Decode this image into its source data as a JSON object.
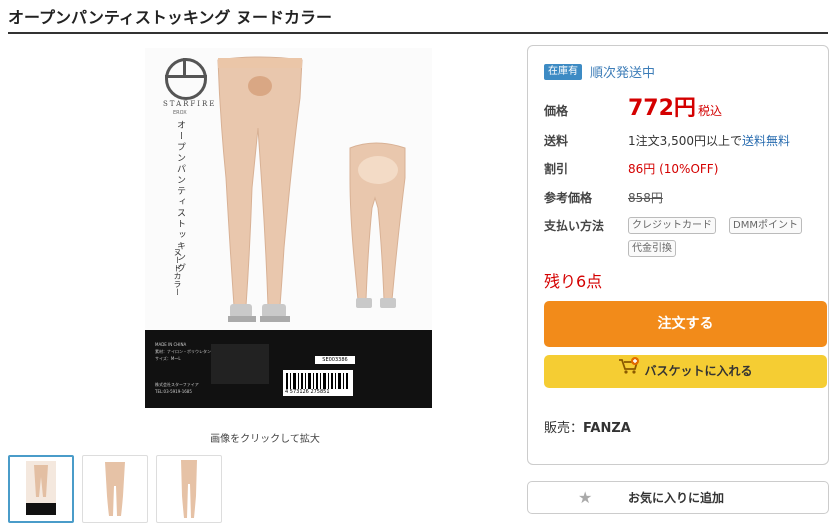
{
  "product": {
    "title": "オープンパンティストッキング ヌードカラー",
    "image_caption": "画像をクリックして拡大",
    "package": {
      "brand": "STARFIRE",
      "brand_sub": "EROX",
      "vertical_title": "オープンパンティストッキング",
      "vertical_sub": "ヌードカラー",
      "made_in": "MADE IN CHINA",
      "material_line": "素材：ナイロン・ポリウレタン",
      "size_line": "サイズ：M〜L",
      "maker_line": "株式会社スターファイア",
      "phone_line": "TEL:03-5919-1685",
      "barcode_number": "4 573126 275851",
      "code_label": "SE003386"
    },
    "thumbnails": [
      {
        "label": "thumb-1",
        "active": true
      },
      {
        "label": "thumb-2",
        "active": false
      },
      {
        "label": "thumb-3",
        "active": false
      }
    ]
  },
  "purchase": {
    "stock_badge": "在庫有",
    "shipping_status": "順次発送中",
    "price_label": "価格",
    "price": "772円",
    "tax_label": "税込",
    "shipping_label": "送料",
    "shipping_text": "1注文3,500円以上で",
    "shipping_link": "送料無料",
    "discount_label": "割引",
    "discount_value": "86円 (10%OFF)",
    "ref_price_label": "参考価格",
    "ref_price": "858円",
    "payment_label": "支払い方法",
    "payment_methods": [
      "クレジットカード",
      "DMMポイント",
      "代金引換"
    ],
    "remaining": "残り6点",
    "order_button": "注文する",
    "basket_button": "バスケットに入れる",
    "seller_label": "販売：",
    "seller_name": "FANZA",
    "favorite_button": "お気に入りに追加"
  },
  "colors": {
    "accent_blue": "#3d8bc4",
    "price_red": "#d40000",
    "order_orange": "#f28b1a",
    "basket_yellow": "#f5cd33"
  }
}
